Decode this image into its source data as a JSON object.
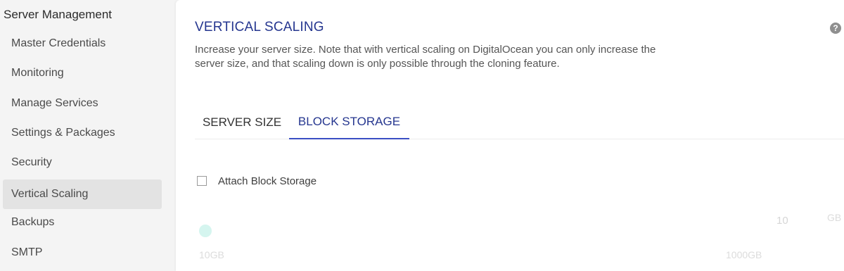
{
  "sidebar": {
    "title": "Server Management",
    "items": [
      {
        "label": "Master Credentials"
      },
      {
        "label": "Monitoring"
      },
      {
        "label": "Manage Services"
      },
      {
        "label": "Settings & Packages"
      },
      {
        "label": "Security"
      },
      {
        "label": "Vertical Scaling",
        "active": true
      },
      {
        "label": "Backups"
      },
      {
        "label": "SMTP"
      }
    ]
  },
  "main": {
    "title": "VERTICAL SCALING",
    "help_icon": "?",
    "description": "Increase your server size. Note that with vertical scaling on DigitalOcean you can only increase the server size, and that scaling down is only possible through the cloning feature.",
    "tabs": [
      {
        "label": "SERVER SIZE"
      },
      {
        "label": "BLOCK STORAGE",
        "active": true
      }
    ],
    "block_storage": {
      "checkbox_label": "Attach Block Storage",
      "checked": false,
      "size_value": "10",
      "unit": "GB",
      "slider_min": "10GB",
      "slider_max": "1000GB"
    }
  },
  "colors": {
    "accent": "#25368f",
    "tab_underline": "#3b4fc4",
    "slider_handle": "#d5f5ef",
    "active_item_bg": "#e3e3e3"
  }
}
